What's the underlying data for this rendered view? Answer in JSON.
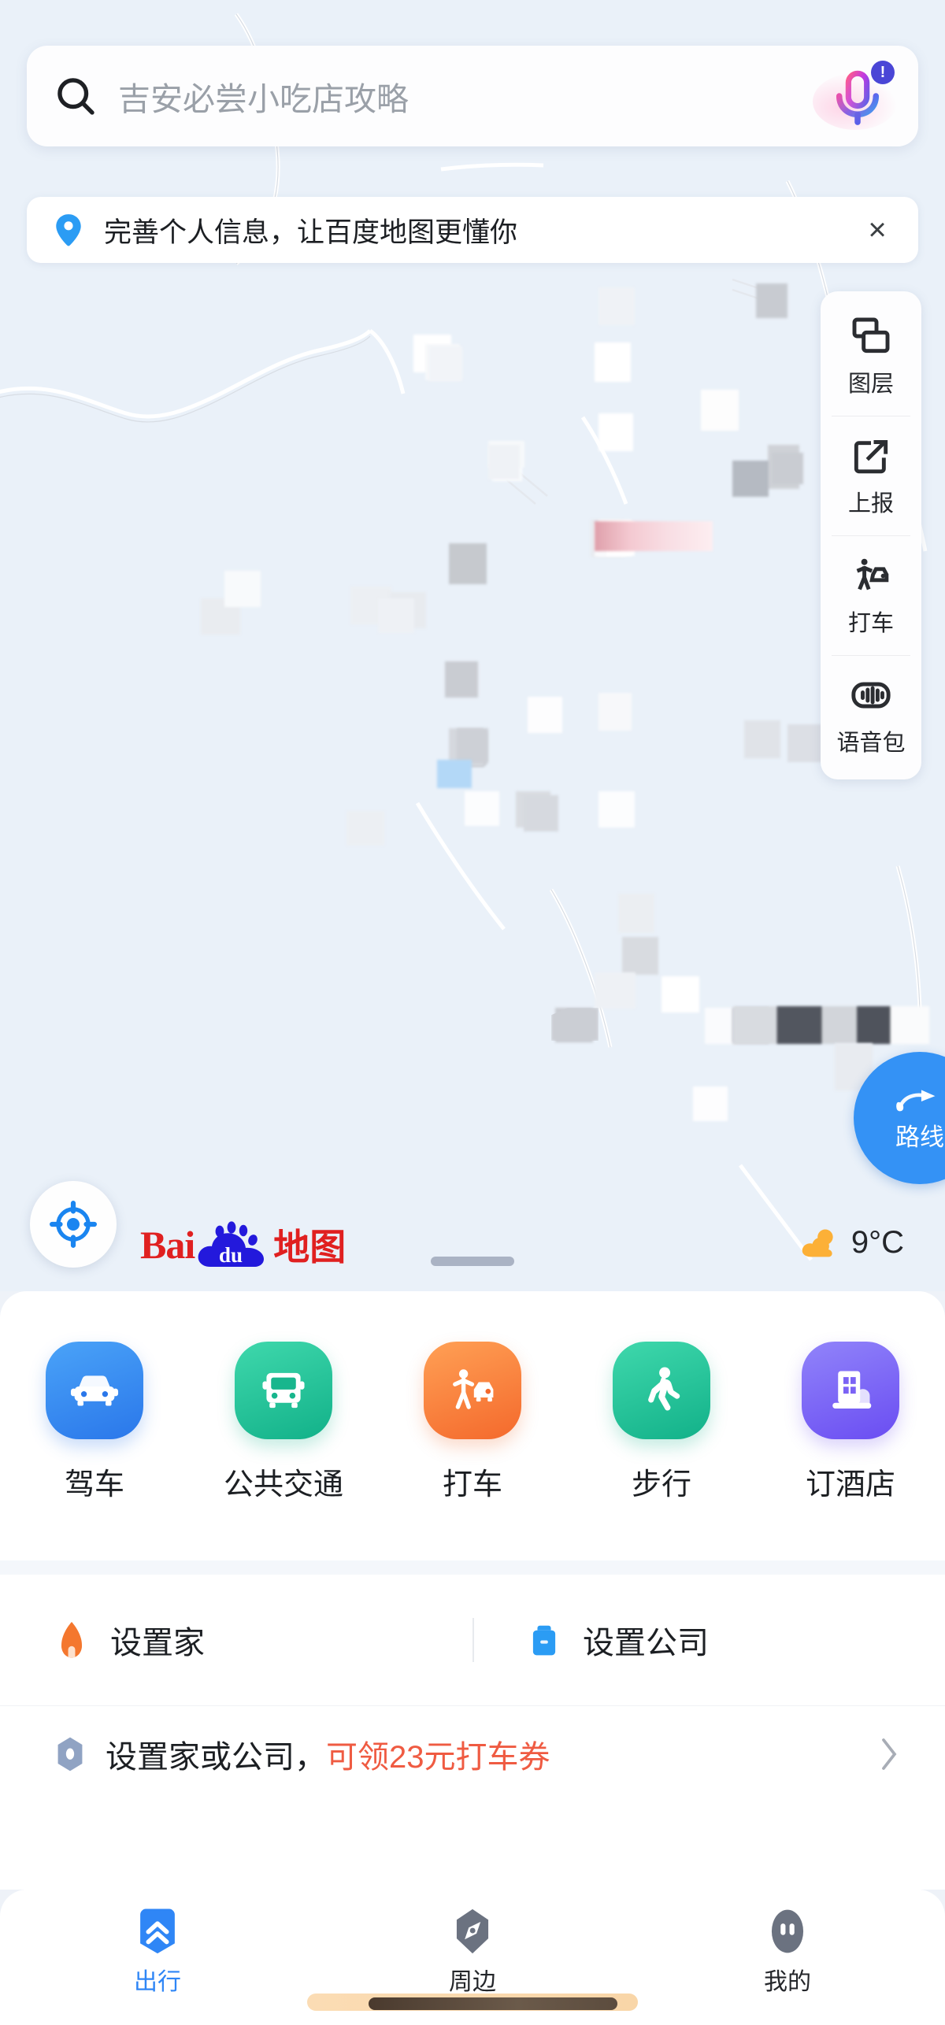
{
  "search": {
    "placeholder": "吉安必尝小吃店攻略",
    "icon": "search-icon",
    "mic_icon": "microphone-icon",
    "mic_badge": "!"
  },
  "banner": {
    "icon": "location-pin-icon",
    "text": "完善个人信息，让百度地图更懂你",
    "close": "×"
  },
  "map": {
    "tools": [
      {
        "label": "图层",
        "icon": "layers-icon"
      },
      {
        "label": "上报",
        "icon": "report-edit-icon"
      },
      {
        "label": "打车",
        "icon": "taxi-hail-icon"
      },
      {
        "label": "语音包",
        "icon": "voice-pack-icon"
      }
    ],
    "route_button": {
      "label": "路线",
      "icon": "route-arrow-icon",
      "color": "#3492f5"
    },
    "locate_button": {
      "icon": "locate-crosshair-icon",
      "color": "#1a85f0"
    },
    "logo": {
      "bai": "Bai",
      "du": "du",
      "suffix": "地图",
      "red": "#e02020",
      "blue": "#2319dc"
    },
    "weather": {
      "temp": "9°C",
      "icon": "sun-cloud-icon",
      "color": "#fcb037"
    },
    "drag_handle": "drag-handle"
  },
  "quick_actions": [
    {
      "label": "驾车",
      "icon": "car-icon",
      "c1": "#4aa3f8",
      "c2": "#2a77ea"
    },
    {
      "label": "公共交通",
      "icon": "bus-icon",
      "c1": "#3fd8ac",
      "c2": "#16b98c"
    },
    {
      "label": "打车",
      "icon": "taxi-icon",
      "c1": "#ff9a4d",
      "c2": "#f4692c"
    },
    {
      "label": "步行",
      "icon": "walk-icon",
      "c1": "#3fd8ac",
      "c2": "#16b98c"
    },
    {
      "label": "订酒店",
      "icon": "hotel-icon",
      "c1": "#8d7bf8",
      "c2": "#6a4df2"
    }
  ],
  "shortcuts": [
    {
      "label": "设置家",
      "icon": "home-icon",
      "color": "#f4772e"
    },
    {
      "label": "设置公司",
      "icon": "briefcase-icon",
      "color": "#2b9cf4"
    }
  ],
  "promo": {
    "icon": "hexagon-marker-icon",
    "text_plain": "设置家或公司，",
    "text_highlight": "可领23元打车券",
    "highlight_color": "#ef5b42",
    "chevron": "chevron-right-icon"
  },
  "bottom_nav": [
    {
      "label": "出行",
      "icon": "chevrons-up-icon",
      "active": true
    },
    {
      "label": "周边",
      "icon": "nearby-compass-icon",
      "active": false
    },
    {
      "label": "我的",
      "icon": "profile-icon",
      "active": false
    }
  ]
}
